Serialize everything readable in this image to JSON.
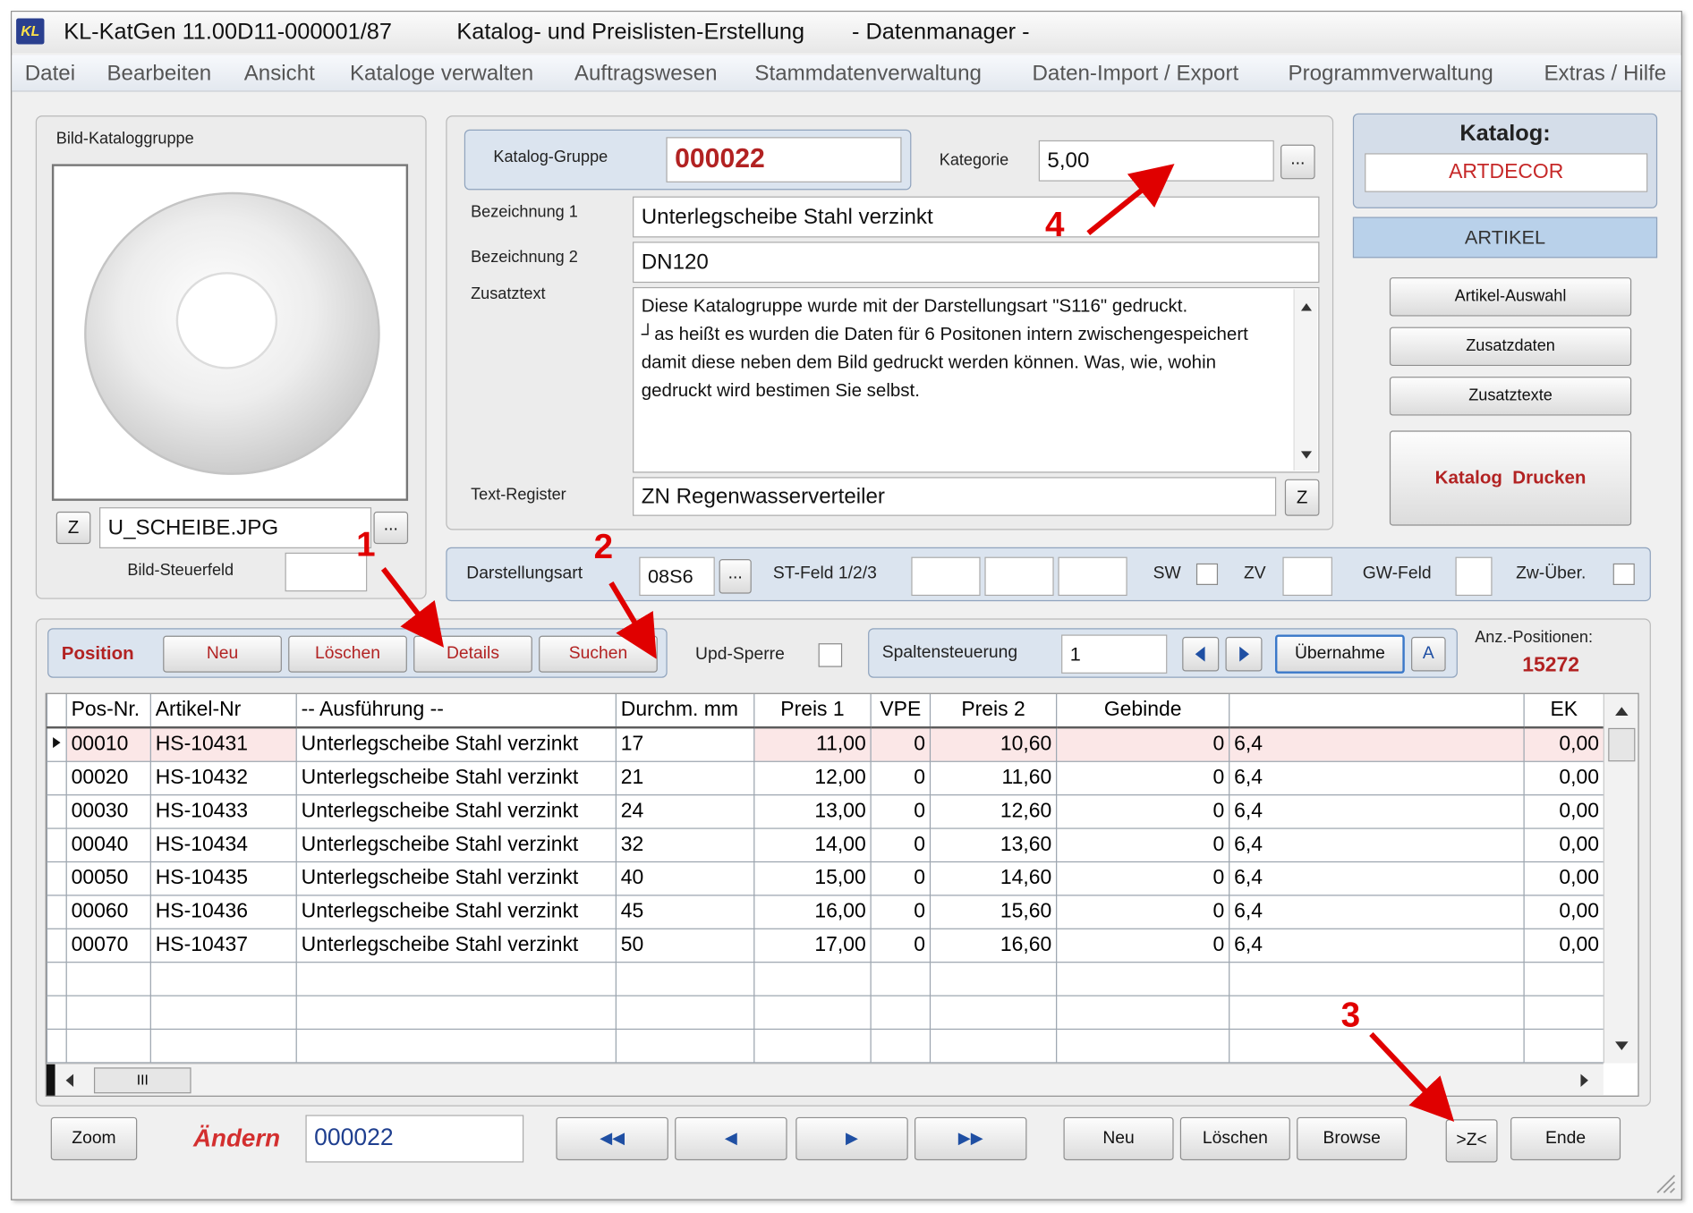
{
  "window": {
    "app_name": "KL-KatGen 11.00D11-000001/87",
    "app_subtitle": "Katalog- und Preislisten-Erstellung",
    "module": "- Datenmanager -",
    "app_icon_text": "KL"
  },
  "menu": [
    "Datei",
    "Bearbeiten",
    "Ansicht",
    "Kataloge verwalten",
    "Auftragswesen",
    "Stammdatenverwaltung",
    "Daten-Import / Export",
    "Programmverwaltung",
    "Extras / Hilfe"
  ],
  "image_panel": {
    "title": "Bild-Kataloggruppe",
    "z_button": "Z",
    "filename": "U_SCHEIBE.JPG",
    "browse_button": "...",
    "control_field_label": "Bild-Steuerfeld",
    "control_field_value": ""
  },
  "group_panel": {
    "group_label": "Katalog-Gruppe",
    "group_value": "000022",
    "category_label": "Kategorie",
    "category_value": "5,00",
    "category_button": "...",
    "desc1_label": "Bezeichnung 1",
    "desc1_value": "Unterlegscheibe Stahl verzinkt",
    "desc2_label": "Bezeichnung 2",
    "desc2_value": "DN120",
    "extra_label": "Zusatztext",
    "extra_text": "Diese Katalogruppe wurde mit der Darstellungsart \"S116\" gedruckt.\n┘as heißt es wurden die Daten für 6 Positonen intern zwischengespeichert damit diese neben dem Bild gedruckt werden können. Was, wie, wohin gedruckt wird bestimen Sie selbst.",
    "register_label": "Text-Register",
    "register_value": "ZN Regenwasserverteiler",
    "register_button": "Z"
  },
  "catalog_panel": {
    "title": "Katalog:",
    "catalog_name": "ARTDECOR",
    "section": "ARTIKEL",
    "btn_article_select": "Artikel-Auswahl",
    "btn_additional_data": "Zusatzdaten",
    "btn_additional_texts": "Zusatztexte",
    "btn_print_catalog": "Katalog  Drucken"
  },
  "display_bar": {
    "mode_label": "Darstellungsart",
    "mode_value": "08S6",
    "mode_button": "...",
    "st_label": "ST-Feld 1/2/3",
    "sw_label": "SW",
    "zv_label": "ZV",
    "gw_label": "GW-Feld",
    "zw_label": "Zw-Über."
  },
  "position_bar": {
    "label": "Position",
    "new": "Neu",
    "delete": "Löschen",
    "details": "Details",
    "search": "Suchen",
    "upd_lock": "Upd-Sperre",
    "columns_label": "Spaltensteuerung",
    "columns_value": "1",
    "apply": "Übernahme",
    "a_button": "A",
    "count_label": "Anz.-Positionen:",
    "count_value": "15272"
  },
  "table": {
    "columns": [
      "Pos-Nr.",
      "Artikel-Nr",
      "-- Ausführung --",
      "Durchm. mm",
      "Preis 1",
      "VPE",
      "Preis 2",
      "Gebinde",
      "",
      "EK"
    ],
    "rows": [
      [
        "00010",
        "HS-10431",
        "Unterlegscheibe Stahl verzinkt",
        "17",
        "11,00",
        "0",
        "10,60",
        "0",
        "6,4",
        "0,00"
      ],
      [
        "00020",
        "HS-10432",
        "Unterlegscheibe Stahl verzinkt",
        "21",
        "12,00",
        "0",
        "11,60",
        "0",
        "6,4",
        "0,00"
      ],
      [
        "00030",
        "HS-10433",
        "Unterlegscheibe Stahl verzinkt",
        "24",
        "13,00",
        "0",
        "12,60",
        "0",
        "6,4",
        "0,00"
      ],
      [
        "00040",
        "HS-10434",
        "Unterlegscheibe Stahl verzinkt",
        "32",
        "14,00",
        "0",
        "13,60",
        "0",
        "6,4",
        "0,00"
      ],
      [
        "00050",
        "HS-10435",
        "Unterlegscheibe Stahl verzinkt",
        "40",
        "15,00",
        "0",
        "14,60",
        "0",
        "6,4",
        "0,00"
      ],
      [
        "00060",
        "HS-10436",
        "Unterlegscheibe Stahl verzinkt",
        "45",
        "16,00",
        "0",
        "15,60",
        "0",
        "6,4",
        "0,00"
      ],
      [
        "00070",
        "HS-10437",
        "Unterlegscheibe Stahl verzinkt",
        "50",
        "17,00",
        "0",
        "16,60",
        "0",
        "6,4",
        "0,00"
      ]
    ],
    "hscroll_thumb": "III"
  },
  "footer": {
    "zoom": "Zoom",
    "mode_text": "Ändern",
    "record_value": "000022",
    "first": "◀◀",
    "prev": "◀",
    "next": "▶",
    "last": "▶▶",
    "new": "Neu",
    "delete": "Löschen",
    "browse": "Browse",
    "zoom_z": ">Z<",
    "end": "Ende"
  },
  "annotations": [
    "1",
    "2",
    "3",
    "4"
  ],
  "colors": {
    "accent_red": "#b22222",
    "annotation_red": "#e00000",
    "panel_blue": "#dbe4ef",
    "selected_row": "#fbe7e7"
  }
}
